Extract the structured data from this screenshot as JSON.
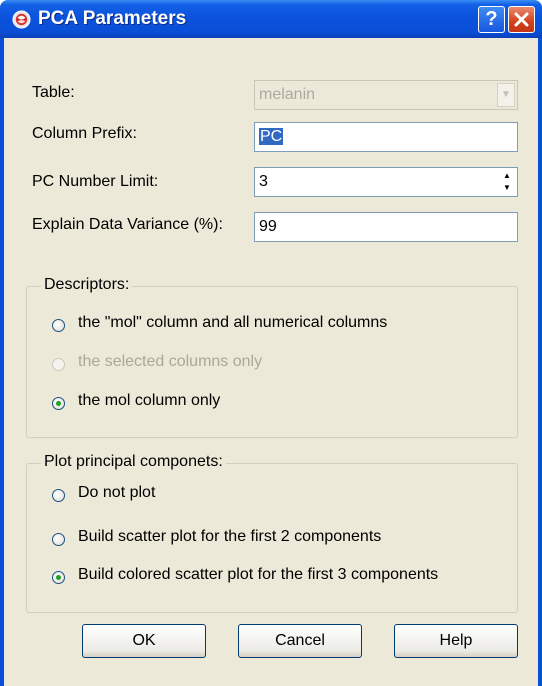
{
  "window": {
    "title": "PCA Parameters",
    "help_glyph": "?",
    "close_glyph": "×",
    "accent_color": "#0a4ed6"
  },
  "form": {
    "table_label": "Table:",
    "table_value": "melanin",
    "prefix_label": "Column Prefix:",
    "prefix_value": "PC",
    "limit_label": "PC Number Limit:",
    "limit_value": "3",
    "variance_label": "Explain Data Variance (%):",
    "variance_value": "99"
  },
  "descriptors": {
    "legend": "Descriptors:",
    "options": [
      {
        "label": "the \"mol\" column and all numerical columns",
        "checked": false,
        "disabled": false
      },
      {
        "label": "the selected columns only",
        "checked": false,
        "disabled": true
      },
      {
        "label": "the mol column only",
        "checked": true,
        "disabled": false
      }
    ]
  },
  "plot": {
    "legend": "Plot principal componets:",
    "options": [
      {
        "label": "Do not plot",
        "checked": false
      },
      {
        "label": "Build scatter plot for the first 2 components",
        "checked": false
      },
      {
        "label": "Build colored scatter plot for the first 3 components",
        "checked": true
      }
    ]
  },
  "buttons": {
    "ok": "OK",
    "cancel": "Cancel",
    "help": "Help"
  }
}
